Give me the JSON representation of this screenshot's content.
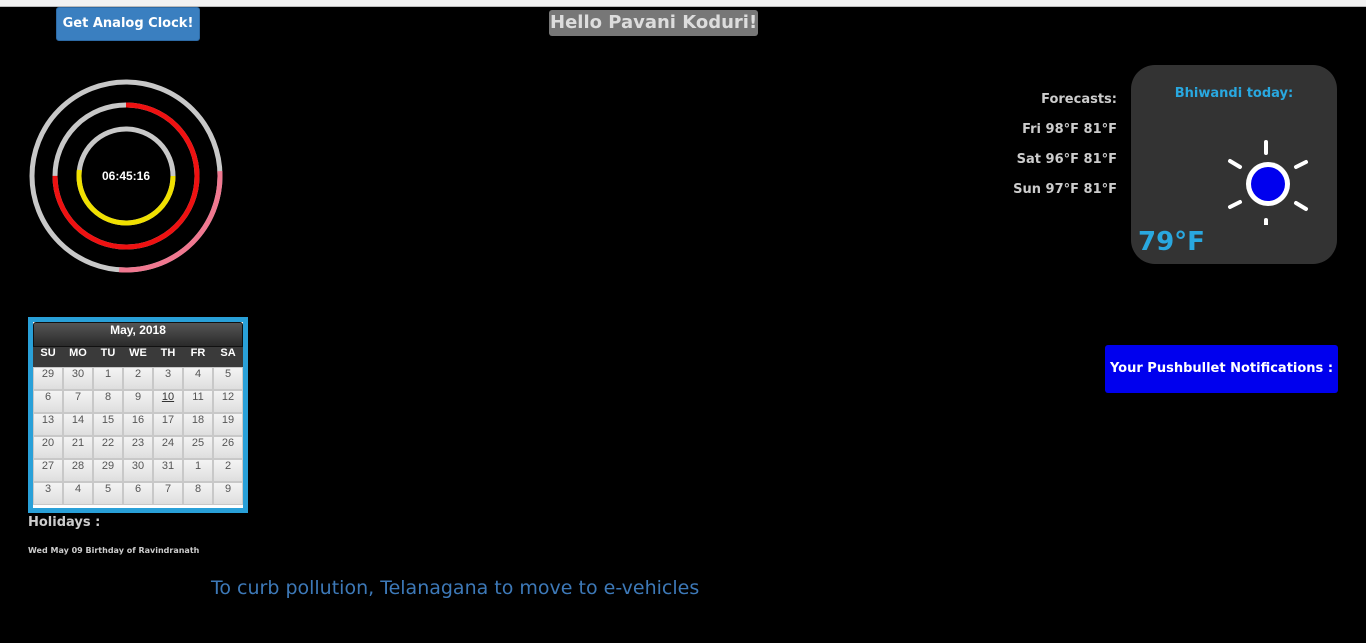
{
  "header": {
    "analog_button_label": "Get Analog Clock!",
    "greeting": "Hello Pavani Koduri!"
  },
  "clock": {
    "time": "06:45:16",
    "hours_fraction": 0.52,
    "minutes_fraction": 0.75,
    "seconds_fraction": 0.27,
    "colors": {
      "track": "#c8c8c8",
      "hours": "#f0e000",
      "minutes": "#ee1111",
      "seconds": "#f07890"
    }
  },
  "forecast": {
    "title": "Forecasts:",
    "days": [
      "Fri 98°F 81°F",
      "Sat 96°F 81°F",
      "Sun 97°F 81°F"
    ]
  },
  "weather": {
    "location": "Bhiwandi today:",
    "temperature": "79°F",
    "icon": "sun-icon",
    "accent": "#29a8e0"
  },
  "calendar": {
    "month": "May, 2018",
    "weekdays": [
      "SU",
      "MO",
      "TU",
      "WE",
      "TH",
      "FR",
      "SA"
    ],
    "weeks": [
      [
        "29",
        "30",
        "1",
        "2",
        "3",
        "4",
        "5"
      ],
      [
        "6",
        "7",
        "8",
        "9",
        "10",
        "11",
        "12"
      ],
      [
        "13",
        "14",
        "15",
        "16",
        "17",
        "18",
        "19"
      ],
      [
        "20",
        "21",
        "22",
        "23",
        "24",
        "25",
        "26"
      ],
      [
        "27",
        "28",
        "29",
        "30",
        "31",
        "1",
        "2"
      ],
      [
        "3",
        "4",
        "5",
        "6",
        "7",
        "8",
        "9"
      ]
    ],
    "today": "10"
  },
  "holidays": {
    "title": "Holidays :",
    "items": [
      "Wed May 09 Birthday of Ravindranath"
    ]
  },
  "news": {
    "headline": "To curb pollution, Telanagana to move to e-vehicles"
  },
  "pushbullet": {
    "label": "Your Pushbullet Notifications :",
    "color": "#0000ee"
  }
}
